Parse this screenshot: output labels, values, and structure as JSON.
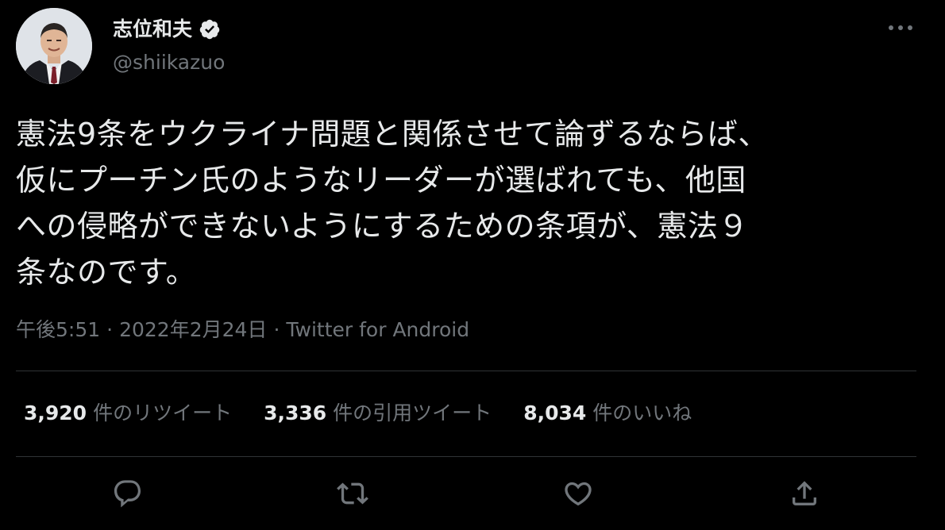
{
  "user": {
    "display_name": "志位和夫",
    "handle": "@shiikazuo",
    "verified": true
  },
  "tweet": {
    "text": "憲法9条をウクライナ問題と関係させて論ずるならば、\n仮にプーチン氏のようなリーダーが選ばれても、他国\nへの侵略ができないようにするための条項が、憲法９\n条なのです。",
    "time": "午後5:51",
    "date": "2022年2月24日",
    "source": "Twitter for Android",
    "separator": "·"
  },
  "stats": {
    "retweets": {
      "count": "3,920",
      "label": "件のリツイート"
    },
    "quotes": {
      "count": "3,336",
      "label": "件の引用ツイート"
    },
    "likes": {
      "count": "8,034",
      "label": "件のいいね"
    }
  },
  "icons": {
    "more": "more-horizontal-icon",
    "verified": "verified-badge-icon",
    "reply": "reply-icon",
    "retweet": "retweet-icon",
    "like": "heart-icon",
    "share": "share-icon"
  },
  "colors": {
    "background": "#000000",
    "text_primary": "#e7e9ea",
    "text_secondary": "#71767b",
    "divider": "#2f3336",
    "verified": "#e7e9ea"
  }
}
